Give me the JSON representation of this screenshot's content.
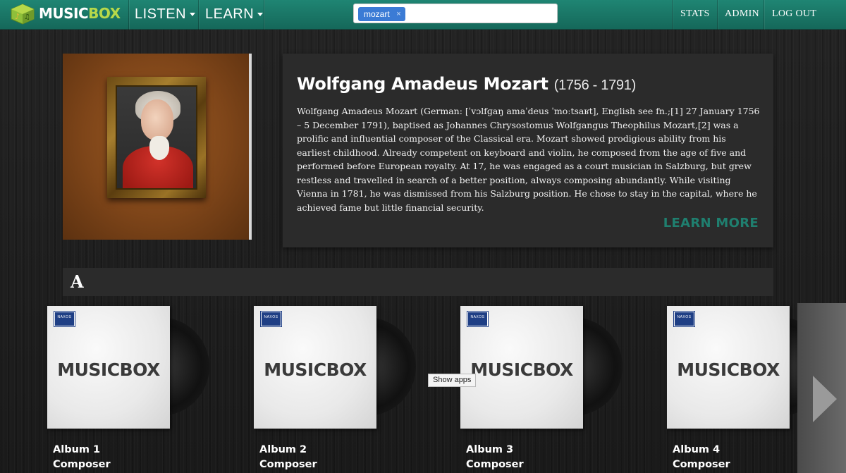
{
  "header": {
    "logo": {
      "part1": "MUSIC",
      "part2": "BOX"
    },
    "nav": [
      {
        "label": "LISTEN"
      },
      {
        "label": "LEARN"
      }
    ],
    "search": {
      "tag": "mozart",
      "tag_remove": "×"
    },
    "right_nav": [
      {
        "label": "STATS"
      },
      {
        "label": "ADMIN"
      },
      {
        "label": "LOG OUT"
      }
    ]
  },
  "composer": {
    "name": "Wolfgang Amadeus Mozart",
    "years": "(1756 - 1791)",
    "bio": "Wolfgang Amadeus Mozart (German: [ˈvɔlfɡaŋ amaˈdeus ˈmoːtsaʁt], English see fn.;[1] 27 January 1756 – 5 December 1791), baptised as Johannes Chrysostomus Wolfgangus Theophilus Mozart,[2] was a prolific and influential composer of the Classical era. Mozart showed prodigious ability from his earliest childhood. Already competent on keyboard and violin, he composed from the age of five and performed before European royalty. At 17, he was engaged as a court musician in Salzburg, but grew restless and travelled in search of a better position, always composing abundantly. While visiting Vienna in 1781, he was dismissed from his Salzburg position. He chose to stay in the capital, where he achieved fame but little financial security.",
    "learn_more": "LEARN MORE"
  },
  "section": {
    "letter": "A"
  },
  "albums": [
    {
      "cover_label": "MUSICBOX",
      "badge": "NAXOS",
      "title": "Album 1",
      "composer": "Composer"
    },
    {
      "cover_label": "MUSICBOX",
      "badge": "NAXOS",
      "title": "Album 2",
      "composer": "Composer"
    },
    {
      "cover_label": "MUSICBOX",
      "badge": "NAXOS",
      "title": "Album 3",
      "composer": "Composer"
    },
    {
      "cover_label": "MUSICBOX",
      "badge": "NAXOS",
      "title": "Album 4",
      "composer": "Composer"
    }
  ],
  "tooltip": "Show apps",
  "colors": {
    "navbar": "#1a7a6a",
    "accent_learn_more": "#1f7f6f",
    "tag_blue": "#3b7bd5",
    "logo_green": "#b7d84a"
  },
  "icons": {
    "logo": "musicbox-cube-icon",
    "carousel_next": "chevron-right-icon",
    "dropdown": "caret-down-icon"
  }
}
